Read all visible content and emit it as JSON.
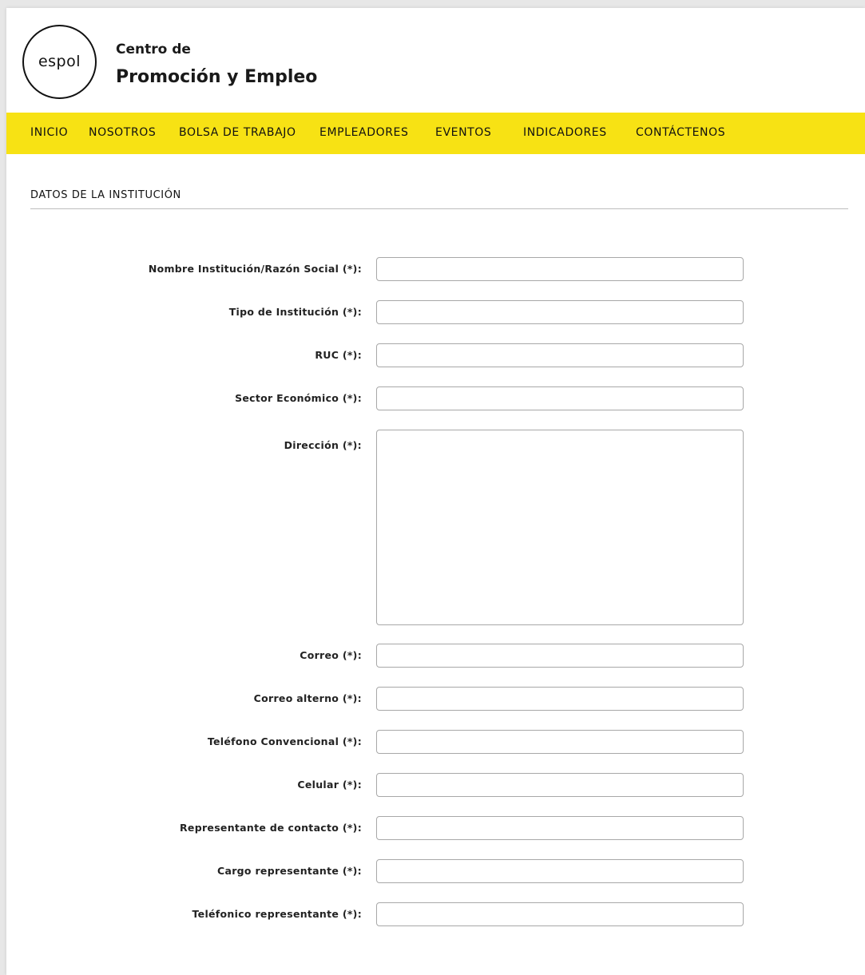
{
  "brand": {
    "logo_text": "espol",
    "line1": "Centro de",
    "line2": "Promoción y Empleo"
  },
  "colors": {
    "nav_background": "#f7e214"
  },
  "nav": {
    "items": [
      {
        "label": "INICIO"
      },
      {
        "label": "NOSOTROS"
      },
      {
        "label": "BOLSA DE TRABAJO"
      },
      {
        "label": "EMPLEADORES"
      },
      {
        "label": "EVENTOS"
      },
      {
        "label": "INDICADORES"
      },
      {
        "label": "CONTÁCTENOS"
      }
    ]
  },
  "section": {
    "title": "DATOS DE LA INSTITUCIÓN"
  },
  "form": {
    "fields": [
      {
        "label": "Nombre Institución/Razón Social (*):",
        "value": ""
      },
      {
        "label": "Tipo de Institución (*):",
        "value": ""
      },
      {
        "label": "RUC (*):",
        "value": ""
      },
      {
        "label": "Sector Económico (*):",
        "value": ""
      },
      {
        "label": "Dirección (*):",
        "value": ""
      },
      {
        "label": "Correo (*):",
        "value": ""
      },
      {
        "label": "Correo alterno (*):",
        "value": ""
      },
      {
        "label": "Teléfono Convencional (*):",
        "value": ""
      },
      {
        "label": "Celular (*):",
        "value": ""
      },
      {
        "label": "Representante de contacto (*):",
        "value": ""
      },
      {
        "label": "Cargo representante (*):",
        "value": ""
      },
      {
        "label": "Teléfonico representante (*):",
        "value": ""
      }
    ]
  }
}
